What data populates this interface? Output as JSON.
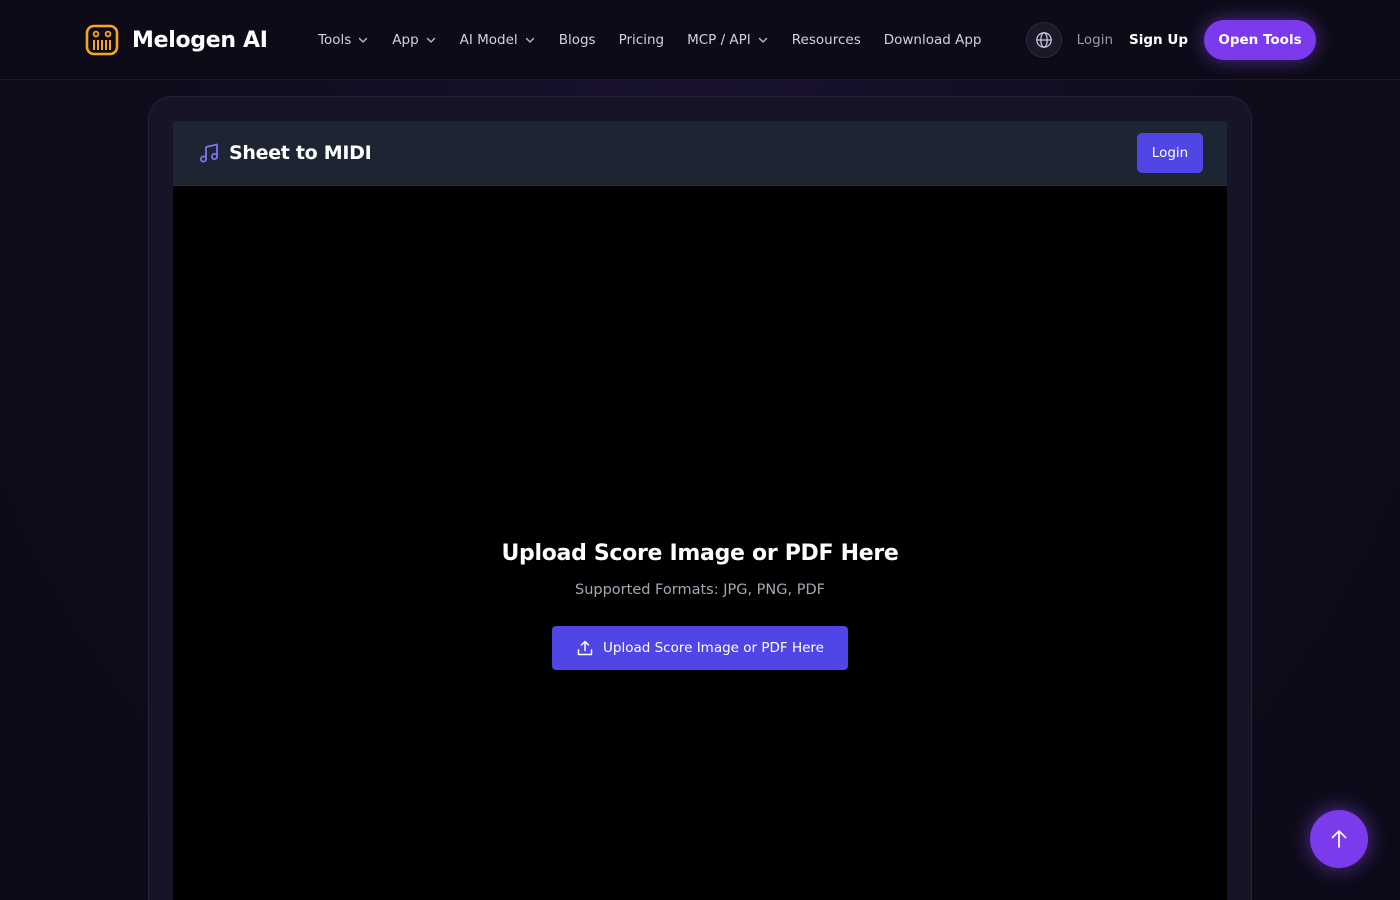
{
  "brand": {
    "name": "Melogen AI",
    "logo_icon": "piano-logo-icon",
    "accent": "#f5a623"
  },
  "nav": {
    "items": [
      {
        "label": "Tools",
        "has_dropdown": true
      },
      {
        "label": "App",
        "has_dropdown": true
      },
      {
        "label": "AI Model",
        "has_dropdown": true
      },
      {
        "label": "Blogs",
        "has_dropdown": false
      },
      {
        "label": "Pricing",
        "has_dropdown": false
      },
      {
        "label": "MCP / API",
        "has_dropdown": true
      },
      {
        "label": "Resources",
        "has_dropdown": false
      },
      {
        "label": "Download App",
        "has_dropdown": false
      }
    ],
    "login_label": "Login",
    "signup_label": "Sign Up",
    "open_tools_label": "Open Tools",
    "language_icon": "globe-icon"
  },
  "tool": {
    "title": "Sheet to MIDI",
    "title_icon": "music-note-icon",
    "login_label": "Login",
    "upload": {
      "heading": "Upload Score Image or PDF Here",
      "formats": "Supported Formats: JPG, PNG, PDF",
      "button_label": "Upload Score Image or PDF Here",
      "button_icon": "upload-icon"
    }
  },
  "scroll_top_icon": "arrow-up-icon",
  "colors": {
    "primary": "#4f46e5",
    "accent_purple": "#7c3aed",
    "background": "#0f0c1c",
    "panel_header": "#1d2532"
  }
}
